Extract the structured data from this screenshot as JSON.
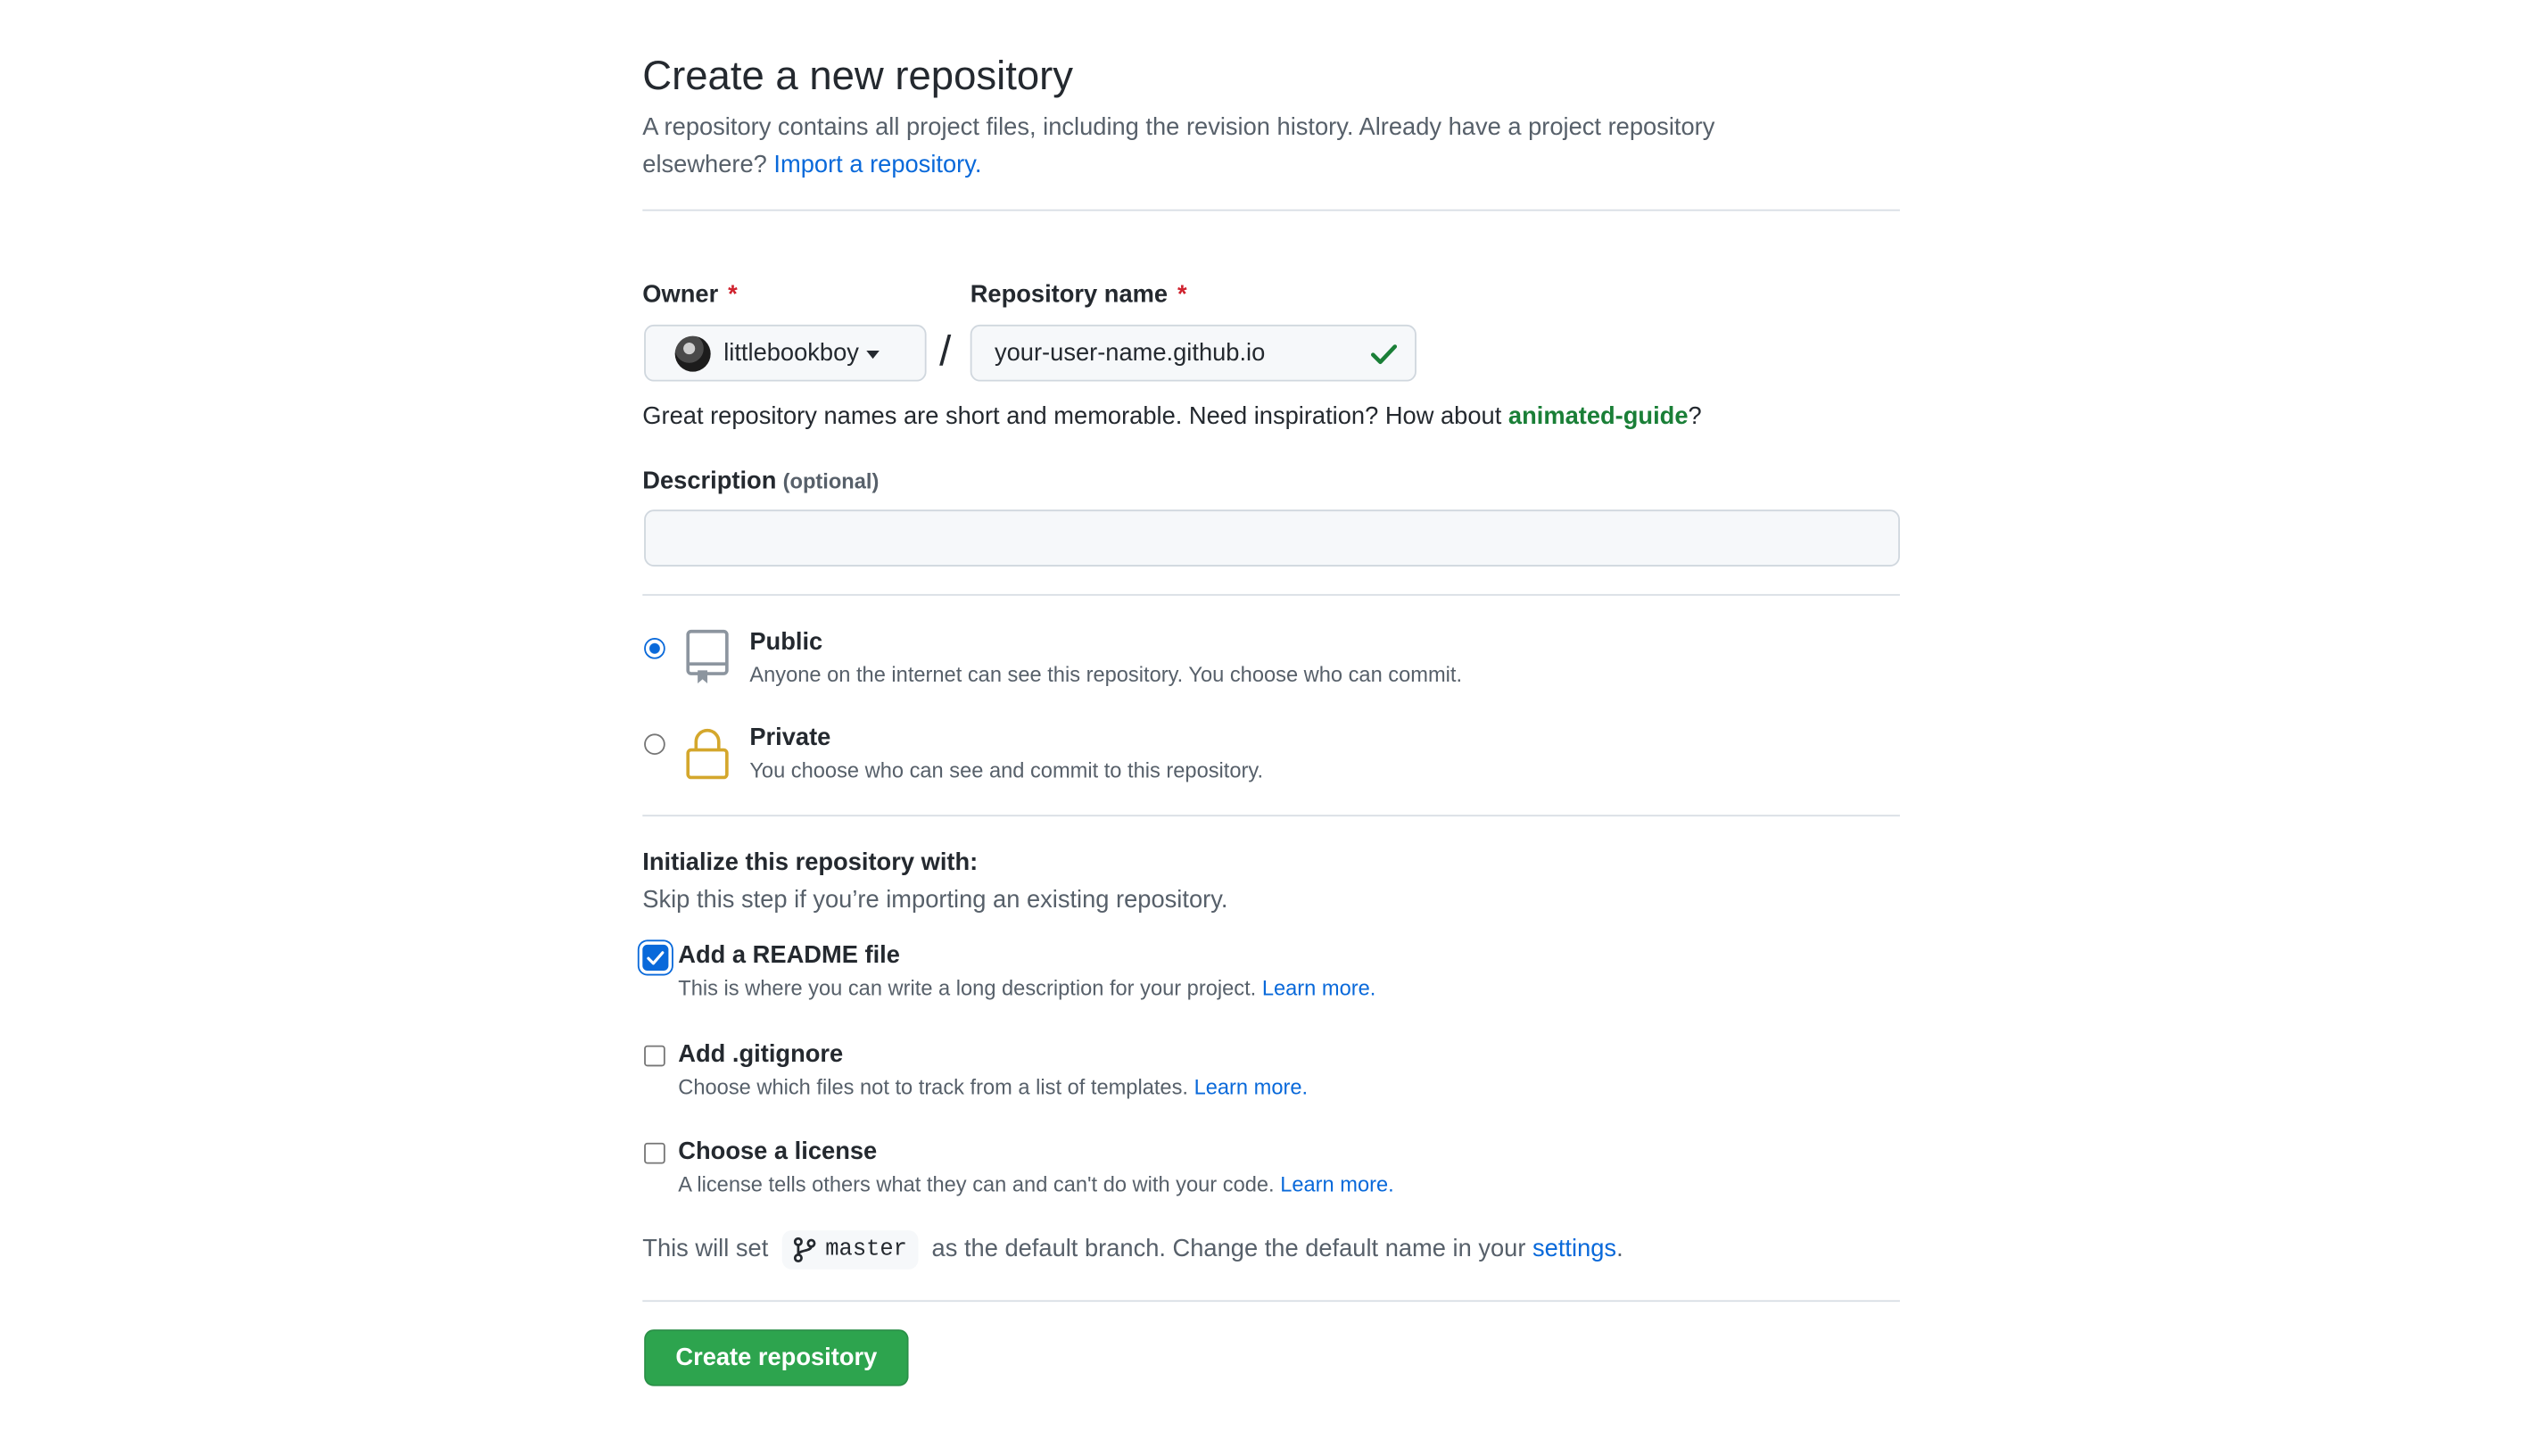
{
  "header": {
    "title": "Create a new repository",
    "lead_text": "A repository contains all project files, including the revision history. Already have a project repository elsewhere?",
    "import_link": "Import a repository."
  },
  "owner": {
    "label": "Owner",
    "required_mark": "*",
    "selected": "littlebookboy"
  },
  "repo_name": {
    "label": "Repository name",
    "required_mark": "*",
    "value": "your-user-name.github.io",
    "valid": true,
    "valid_color": "#1a7f37"
  },
  "separator": "/",
  "name_hint": {
    "text": "Great repository names are short and memorable. Need inspiration? How about",
    "suggestion": "animated-guide",
    "suffix": "?"
  },
  "description": {
    "label": "Description",
    "optional": "(optional)",
    "value": ""
  },
  "visibility": {
    "selected": "public",
    "options": [
      {
        "id": "public",
        "title": "Public",
        "subtitle": "Anyone on the internet can see this repository. You choose who can commit.",
        "icon": "repo-icon"
      },
      {
        "id": "private",
        "title": "Private",
        "subtitle": "You choose who can see and commit to this repository.",
        "icon": "lock-icon"
      }
    ]
  },
  "initialize": {
    "heading": "Initialize this repository with:",
    "subheading": "Skip this step if you’re importing an existing repository.",
    "options": [
      {
        "id": "readme",
        "title": "Add a README file",
        "subtitle": "This is where you can write a long description for your project.",
        "link": "Learn more.",
        "checked": true
      },
      {
        "id": "gitignore",
        "title": "Add .gitignore",
        "subtitle": "Choose which files not to track from a list of templates.",
        "link": "Learn more.",
        "checked": false
      },
      {
        "id": "license",
        "title": "Choose a license",
        "subtitle": "A license tells others what they can and can't do with your code.",
        "link": "Learn more.",
        "checked": false
      }
    ]
  },
  "default_branch": {
    "prefix": "This will set",
    "branch": "master",
    "middle": "as the default branch. Change the default name in your",
    "link": "settings",
    "suffix": "."
  },
  "submit": {
    "label": "Create repository",
    "color": "#2da44e"
  },
  "colors": {
    "link": "#0969da",
    "required": "#cf222e",
    "border": "#d0d7de",
    "muted": "#57606a"
  }
}
